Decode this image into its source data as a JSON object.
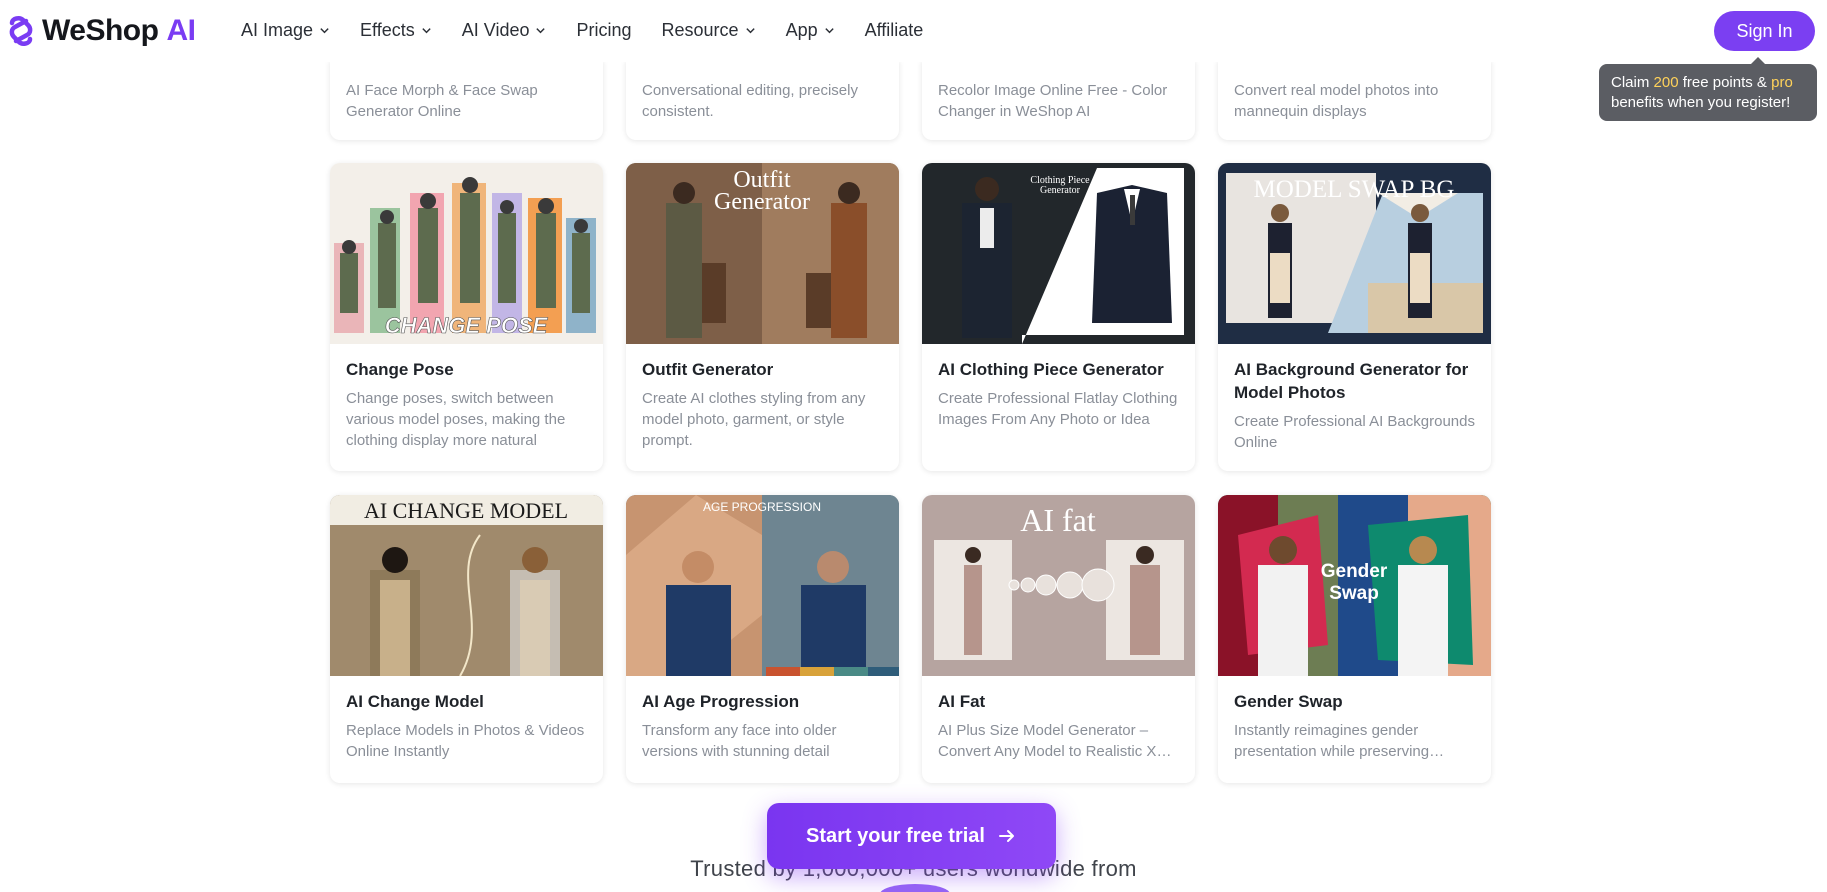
{
  "brand": {
    "name": "WeShop",
    "suffix": "AI",
    "accent": "#7b3ff2"
  },
  "nav": {
    "items": [
      {
        "label": "AI Image",
        "dropdown": true
      },
      {
        "label": "Effects",
        "dropdown": true
      },
      {
        "label": "AI Video",
        "dropdown": true
      },
      {
        "label": "Pricing",
        "dropdown": false
      },
      {
        "label": "Resource",
        "dropdown": true
      },
      {
        "label": "App",
        "dropdown": true
      },
      {
        "label": "Affiliate",
        "dropdown": false
      }
    ],
    "sign_in": "Sign In"
  },
  "tooltip": {
    "pre": "Claim ",
    "points": "200",
    "mid": " free points & ",
    "pro": "pro",
    "post": "benefits when you register!"
  },
  "partial_cards": [
    {
      "desc": "AI Face Morph & Face Swap Generator Online"
    },
    {
      "desc": "Conversational editing, precisely consistent."
    },
    {
      "desc": "Recolor Image Online Free - Color Changer in WeShop AI"
    },
    {
      "desc": "Convert real model photos into mannequin displays"
    }
  ],
  "cards": [
    {
      "title": "Change Pose",
      "desc": "Change poses, switch between various model poses, making the clothing display more natural",
      "image_text": "CHANGE POSE"
    },
    {
      "title": "Outfit Generator",
      "desc": "Create AI clothes styling from any model photo, garment, or style prompt.",
      "image_text_1": "Outfit",
      "image_text_2": "Generator"
    },
    {
      "title": "AI Clothing Piece Generator",
      "desc": "Create Professional Flatlay Clothing Images From Any Photo or Idea",
      "image_text_1": "Clothing Piece",
      "image_text_2": "Generator"
    },
    {
      "title": "AI Background Generator for Model Photos",
      "desc": "Create Professional AI Backgrounds Online",
      "image_text": "MODEL SWAP BG"
    },
    {
      "title": "AI Change Model",
      "desc": "Replace Models in Photos & Videos Online Instantly",
      "image_text": "AI CHANGE MODEL"
    },
    {
      "title": "AI Age Progression",
      "desc": "Transform any face into older versions with stunning detail",
      "image_text": "AGE PROGRESSION"
    },
    {
      "title": "AI Fat",
      "desc": "AI Plus Size Model Generator – Convert Any Model to Realistic XL Sizes",
      "image_text": "AI fat"
    },
    {
      "title": "Gender Swap",
      "desc": "Instantly reimagines gender presentation while preserving identity",
      "image_text_1": "Gender",
      "image_text_2": "Swap"
    }
  ],
  "cta": {
    "label": "Start your free trial"
  },
  "trusted": {
    "text": "Trusted by 1,000,000+ users worldwide from"
  }
}
